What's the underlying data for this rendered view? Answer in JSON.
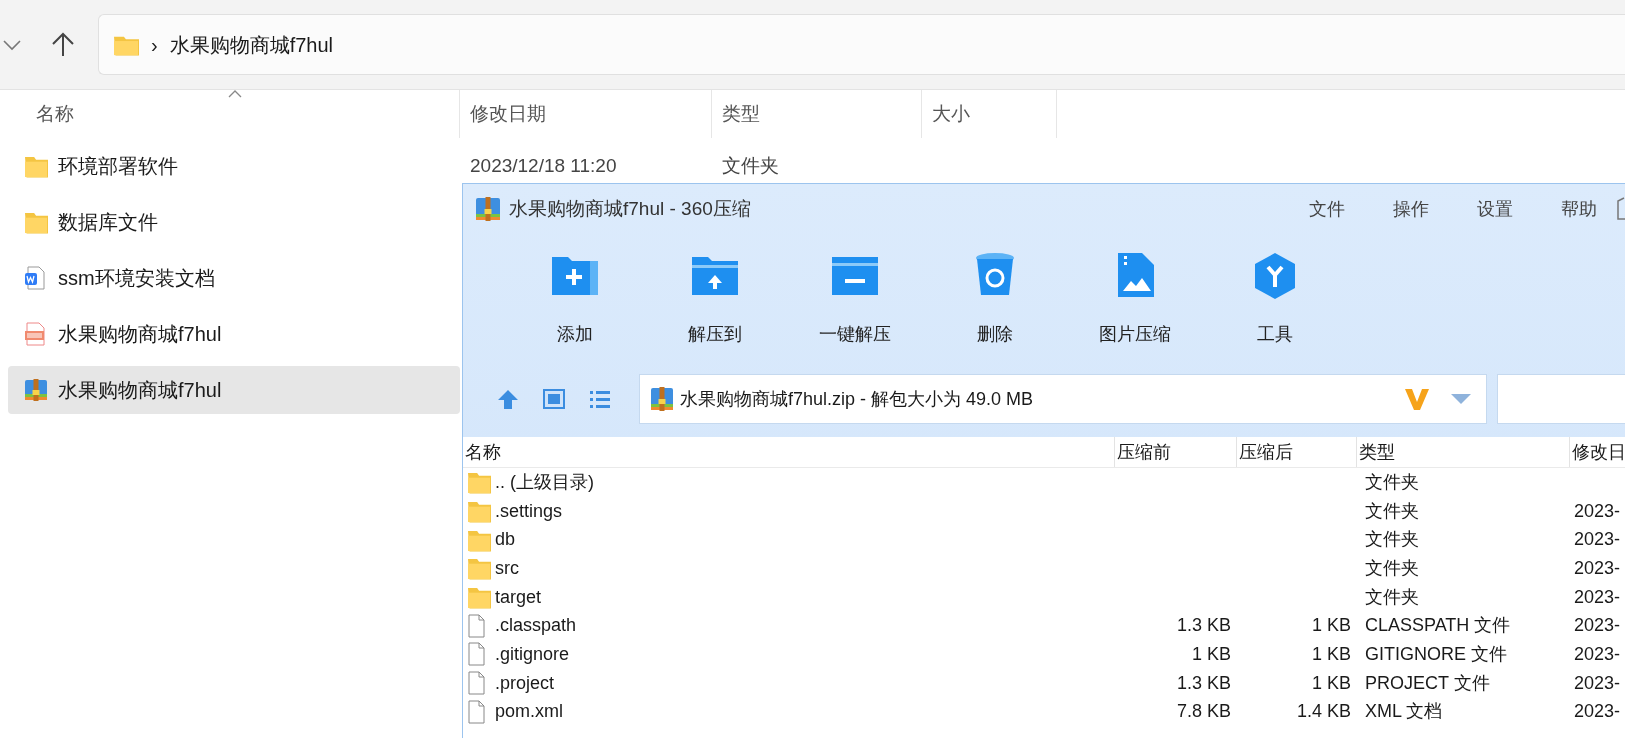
{
  "explorer": {
    "breadcrumb": {
      "separator": "›",
      "folder": "水果购物商城f7hul"
    },
    "columns": [
      "名称",
      "修改日期",
      "类型",
      "大小"
    ],
    "files": [
      {
        "kind": "folder",
        "name": "环境部署软件",
        "modified": "2023/12/18 11:20",
        "type": "文件夹",
        "selected": false
      },
      {
        "kind": "folder",
        "name": "数据库文件",
        "selected": false
      },
      {
        "kind": "word",
        "name": "ssm环境安装文档",
        "selected": false
      },
      {
        "kind": "video",
        "name": "水果购物商城f7hul",
        "selected": false
      },
      {
        "kind": "archive",
        "name": "水果购物商城f7hul",
        "selected": true
      }
    ]
  },
  "archiver": {
    "title": "水果购物商城f7hul - 360压缩",
    "menu": [
      "文件",
      "操作",
      "设置",
      "帮助"
    ],
    "toolbar": [
      {
        "kind": "add",
        "label": "添加"
      },
      {
        "kind": "extract",
        "label": "解压到"
      },
      {
        "kind": "quick",
        "label": "一键解压"
      },
      {
        "kind": "delete",
        "label": "删除"
      },
      {
        "kind": "image",
        "label": "图片压缩"
      },
      {
        "kind": "tools",
        "label": "工具"
      }
    ],
    "path": "水果购物商城f7hul.zip - 解包大小为 49.0 MB",
    "columns": [
      "名称",
      "压缩前",
      "压缩后",
      "类型",
      "修改日"
    ],
    "rows": [
      {
        "kind": "folder",
        "name": ".. (上级目录)",
        "type": "文件夹"
      },
      {
        "kind": "folder",
        "name": ".settings",
        "type": "文件夹",
        "modified": "2023-"
      },
      {
        "kind": "folder",
        "name": "db",
        "type": "文件夹",
        "modified": "2023-"
      },
      {
        "kind": "folder",
        "name": "src",
        "type": "文件夹",
        "modified": "2023-"
      },
      {
        "kind": "folder",
        "name": "target",
        "type": "文件夹",
        "modified": "2023-"
      },
      {
        "kind": "file",
        "name": ".classpath",
        "before": "1.3 KB",
        "after": "1 KB",
        "type": "CLASSPATH 文件",
        "modified": "2023-"
      },
      {
        "kind": "file",
        "name": ".gitignore",
        "before": "1 KB",
        "after": "1 KB",
        "type": "GITIGNORE 文件",
        "modified": "2023-"
      },
      {
        "kind": "file",
        "name": ".project",
        "before": "1.3 KB",
        "after": "1 KB",
        "type": "PROJECT 文件",
        "modified": "2023-"
      },
      {
        "kind": "file",
        "name": "pom.xml",
        "before": "7.8 KB",
        "after": "1.4 KB",
        "type": "XML 文档",
        "modified": "2023-"
      }
    ]
  }
}
